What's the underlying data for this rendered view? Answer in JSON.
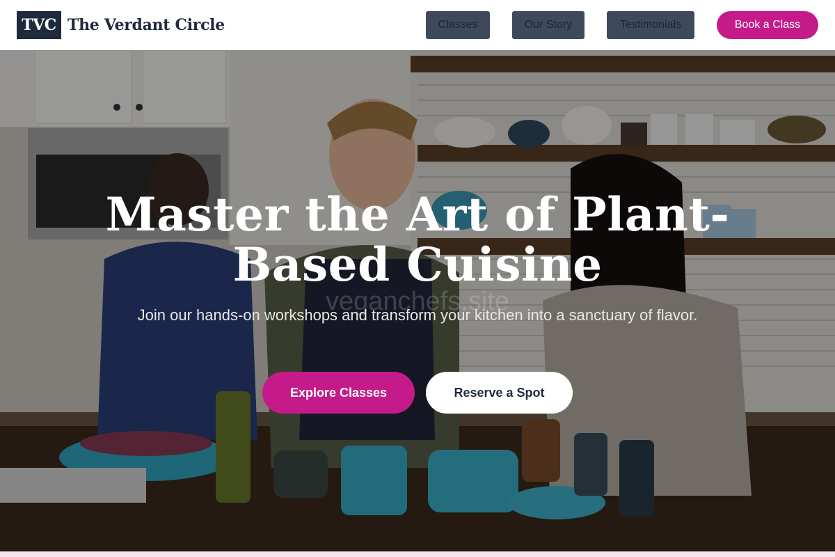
{
  "header": {
    "logo_mark": "TVC",
    "brand_name": "The Verdant Circle",
    "nav": [
      {
        "label": "Classes"
      },
      {
        "label": "Our Story"
      },
      {
        "label": "Testimonials"
      }
    ],
    "cta_label": "Book a Class"
  },
  "hero": {
    "headline_line1": "Master the Art of Plant-",
    "headline_line2": "Based Cuisine",
    "watermark": "veganchefs.site",
    "subline": "Join our hands-on workshops and transform your kitchen into a sanctuary of flavor.",
    "primary_button": "Explore Classes",
    "secondary_button": "Reserve a Spot"
  },
  "colors": {
    "accent": "#c51b8a",
    "nav_bg": "#3e4a5c",
    "brand_dark": "#1f2a3d"
  }
}
